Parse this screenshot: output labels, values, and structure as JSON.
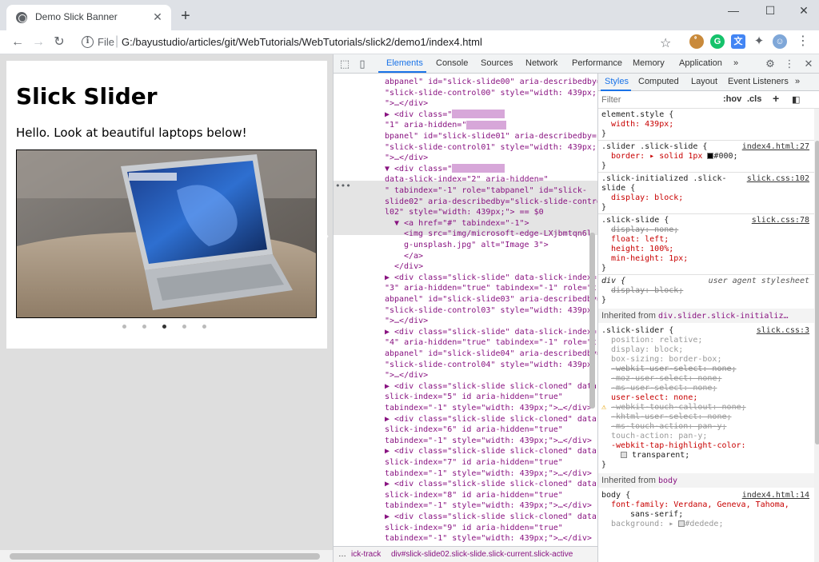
{
  "browser": {
    "tab_title": "Demo Slick Banner",
    "tab_close": "✕",
    "new_tab": "+",
    "window_controls": {
      "minimize": "—",
      "maximize": "☐",
      "close": "✕"
    },
    "nav": {
      "back": "←",
      "forward": "→",
      "reload": "↻"
    },
    "url_scheme": "File",
    "url_separator": "|",
    "url": "G:/bayustudio/articles/git/WebTutorials/WebTutorials/slick2/demo1/index4.html",
    "bookmark_icon": "☆",
    "extensions": [
      "ﾟ",
      "G",
      "文",
      "✦",
      "☺"
    ],
    "menu": "⋮"
  },
  "page": {
    "heading": "Slick Slider",
    "paragraph": "Hello. Look at beautiful laptops below!",
    "slide_image_alt": "Image 3",
    "arrow_prev": "‹",
    "arrow_next": "›",
    "dots_count": 5,
    "active_dot": 2
  },
  "devtools": {
    "tabs": [
      "Elements",
      "Console",
      "Sources",
      "Network",
      "Performance",
      "Memory",
      "Application",
      "»"
    ],
    "active_tab": "Elements",
    "icons": {
      "inspect": "⬚",
      "device": "▯",
      "settings": "⚙",
      "more": "⋮",
      "close": "✕"
    },
    "elements_lines": [
      {
        "html": "abpanel\" id=\"slick-slide00\" aria-describedby="
      },
      {
        "html": "\"slick-slide-control00\" style=\"width: 439px;\">"
      },
      {
        "html": "\">…</div>"
      },
      {
        "html": "▶ <div class=\""
      },
      {
        "html": "\"1\" aria-hidden=\""
      },
      {
        "html": "bpanel\" id=\"slick-slide01\" aria-describedby="
      },
      {
        "html": "\"slick-slide-control01\" style=\"width: 439px;"
      },
      {
        "html": "\">…</div>"
      },
      {
        "html": "▼ <div class=\""
      },
      {
        "html": "data-slick-index=\"2\" aria-hidden=\""
      },
      {
        "html": "\" tabindex=\"-1\" role=\"tabpanel\" id=\"slick-"
      },
      {
        "html": "slide02\" aria-describedby=\"slick-slide-contro"
      },
      {
        "html": "l02\" style=\"width: 439px;\"> == $0"
      },
      {
        "html": "▼ <a href=\"#\" tabindex=\"-1\">"
      },
      {
        "html": "<img src=\"img/microsoft-edge-LXjbmtqn6l"
      },
      {
        "html": "g-unsplash.jpg\" alt=\"Image 3\">"
      },
      {
        "html": "</a>"
      },
      {
        "html": "</div>"
      },
      {
        "html": "▶ <div class=\"slick-slide\" data-slick-index="
      },
      {
        "html": "\"3\" aria-hidden=\"true\" tabindex=\"-1\" role=\"t"
      },
      {
        "html": "abpanel\" id=\"slick-slide03\" aria-describedby="
      },
      {
        "html": "\"slick-slide-control03\" style=\"width: 439px;"
      },
      {
        "html": "\">…</div>"
      },
      {
        "html": "▶ <div class=\"slick-slide\" data-slick-index="
      },
      {
        "html": "\"4\" aria-hidden=\"true\" tabindex=\"-1\" role=\"t"
      },
      {
        "html": "abpanel\" id=\"slick-slide04\" aria-describedby="
      },
      {
        "html": "\"slick-slide-control04\" style=\"width: 439px;"
      },
      {
        "html": "\">…</div>"
      },
      {
        "html": "▶ <div class=\"slick-slide slick-cloned\" data-"
      },
      {
        "html": "slick-index=\"5\" id aria-hidden=\"true\""
      },
      {
        "html": "tabindex=\"-1\" style=\"width: 439px;\">…</div>"
      },
      {
        "html": "▶ <div class=\"slick-slide slick-cloned\" data-"
      },
      {
        "html": "slick-index=\"6\" id aria-hidden=\"true\""
      },
      {
        "html": "tabindex=\"-1\" style=\"width: 439px;\">…</div>"
      },
      {
        "html": "▶ <div class=\"slick-slide slick-cloned\" data-"
      },
      {
        "html": "slick-index=\"7\" id aria-hidden=\"true\""
      },
      {
        "html": "tabindex=\"-1\" style=\"width: 439px;\">…</div>"
      },
      {
        "html": "▶ <div class=\"slick-slide slick-cloned\" data-"
      },
      {
        "html": "slick-index=\"8\" id aria-hidden=\"true\""
      },
      {
        "html": "tabindex=\"-1\" style=\"width: 439px;\">…</div>"
      },
      {
        "html": "▶ <div class=\"slick-slide slick-cloned\" data-"
      },
      {
        "html": "slick-index=\"9\" id aria-hidden=\"true\""
      },
      {
        "html": "tabindex=\"-1\" style=\"width: 439px;\">…</div>"
      }
    ],
    "ellipsis": "•••",
    "breadcrumb": [
      "…",
      "ick-track",
      "div#slick-slide02.slick-slide.slick-current.slick-active"
    ],
    "styles_tabs": [
      "Styles",
      "Computed",
      "Layout",
      "Event Listeners",
      "»"
    ],
    "filter_placeholder": "Filter",
    "filter_buttons": [
      ":hov",
      ".cls",
      "+"
    ],
    "rules": {
      "element_style": "element.style {",
      "element_style_width": "width: 439px;",
      "r1_selector": ".slider .slick-slide {",
      "r1_src": "index4.html:27",
      "r1_border": "border: ▸ solid 1px",
      "r1_border_color": "#000;",
      "r2_selector": ".slick-initialized .slick-",
      "r2_selector2": "slide {",
      "r2_src": "slick.css:102",
      "r2_display": "display: block;",
      "r3_selector": ".slick-slide {",
      "r3_src": "slick.css:78",
      "r3_display": "display: none;",
      "r3_float": "float: left;",
      "r3_height": "height: 100%;",
      "r3_minheight": "min-height: 1px;",
      "r4_selector": "div {",
      "r4_src": "user agent stylesheet",
      "r4_display": "display: block;",
      "inherited1_label": "Inherited from",
      "inherited1_sel": "div.slider.slick-initializ…",
      "r5_selector": ".slick-slider {",
      "r5_src": "slick.css:3",
      "r5_lines": [
        "position: relative;",
        "display: block;",
        "box-sizing: border-box;",
        "-webkit-user-select: none;",
        "-moz-user-select: none;",
        "-ms-user-select: none;",
        "user-select: none;",
        "-webkit-touch-callout: none;",
        "-khtml-user-select: none;",
        "-ms-touch-action: pan-y;",
        "touch-action: pan-y;",
        "-webkit-tap-highlight-color:",
        "transparent;"
      ],
      "inherited2_label": "Inherited from",
      "inherited2_sel": "body",
      "r6_selector": "body {",
      "r6_src": "index4.html:14",
      "r6_font": "font-family: Verdana, Geneva, Tahoma,",
      "r6_font2": "sans-serif;",
      "r6_bg": "background: ▸",
      "r6_bg_color": "#dedede;",
      "close_brace": "}"
    }
  },
  "colors": {
    "accent": "#1a73e8",
    "tag": "#881280",
    "attr": "#994500",
    "value": "#1a1aa6",
    "page_bg": "#dedede"
  }
}
